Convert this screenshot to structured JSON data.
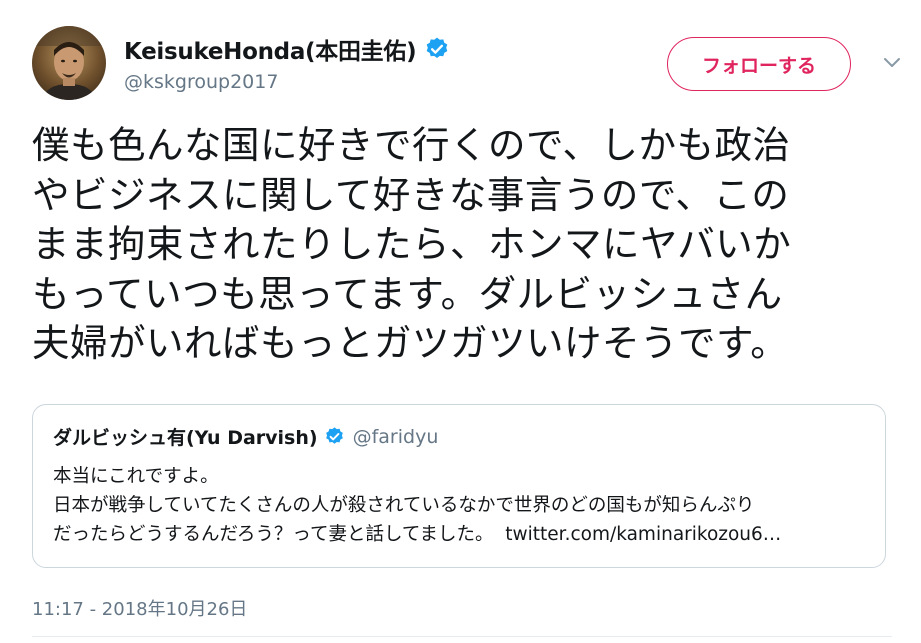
{
  "author": {
    "name": "KeisukeHonda(本田圭佑)",
    "handle": "@kskgroup2017",
    "verified_icon": "verified-badge-icon"
  },
  "follow_button": {
    "label": "フォローする"
  },
  "menu_caret_icon": "chevron-down-icon",
  "tweet": {
    "lines": [
      "僕も色んな国に好きで行くので、しかも政治",
      "やビジネスに関して好きな事言うので、この",
      "まま拘束されたりしたら、ホンマにヤバいか",
      "もっていつも思ってます。ダルビッシュさん",
      "夫婦がいればもっとガツガツいけそうです。"
    ]
  },
  "quote": {
    "name": "ダルビッシュ有(Yu Darvish)",
    "handle": "@faridyu",
    "lines": [
      "本当にこれですよ。",
      "日本が戦争していてたくさんの人が殺されているなかで世界のどの国もが知らんぷり",
      "だったらどうするんだろう？って妻と話してました。"
    ],
    "link": "twitter.com/kaminarikozou6…"
  },
  "timestamp": "11:17 - 2018年10月26日",
  "colors": {
    "follow_accent": "#e0245e",
    "verified_blue": "#1da1f2",
    "secondary_text": "#657786",
    "border": "#ccd6dd"
  }
}
